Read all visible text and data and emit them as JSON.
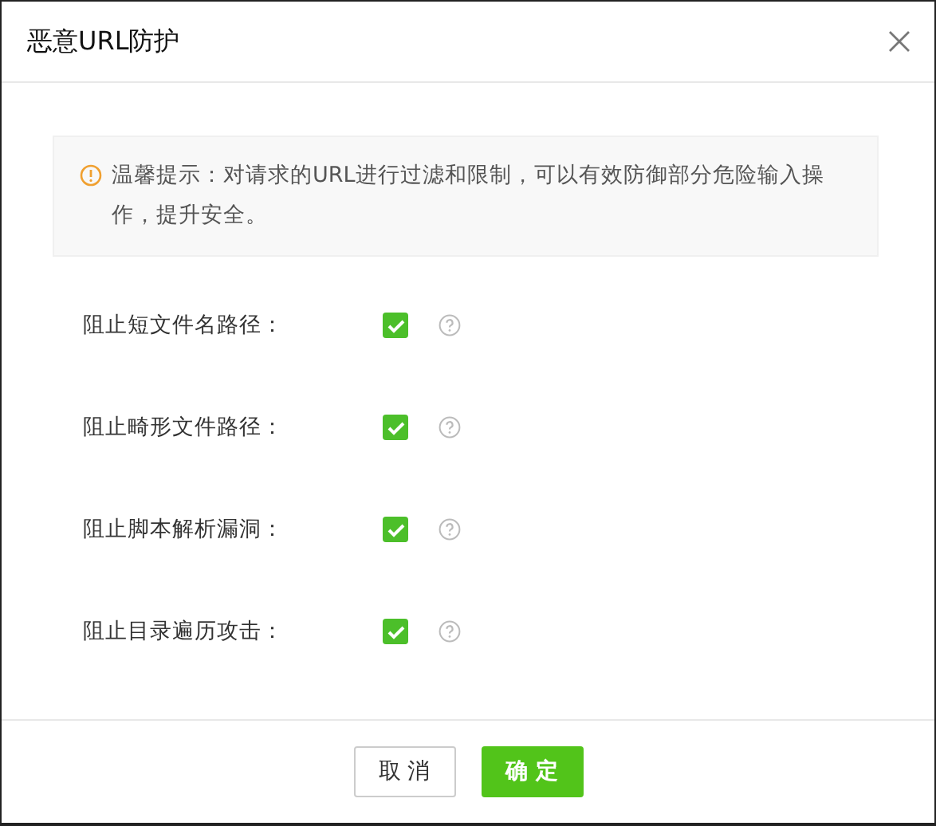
{
  "dialog": {
    "title": "恶意URL防护",
    "notice": "温馨提示：对请求的URL进行过滤和限制，可以有效防御部分危险输入操作，提升安全。",
    "options": [
      {
        "label": "阻止短文件名路径：",
        "checked": true
      },
      {
        "label": "阻止畸形文件路径：",
        "checked": true
      },
      {
        "label": "阻止脚本解析漏洞：",
        "checked": true
      },
      {
        "label": "阻止目录遍历攻击：",
        "checked": true
      }
    ],
    "buttons": [
      {
        "label": "取 消",
        "kind": "secondary"
      },
      {
        "label": "确 定",
        "kind": "primary"
      }
    ]
  }
}
